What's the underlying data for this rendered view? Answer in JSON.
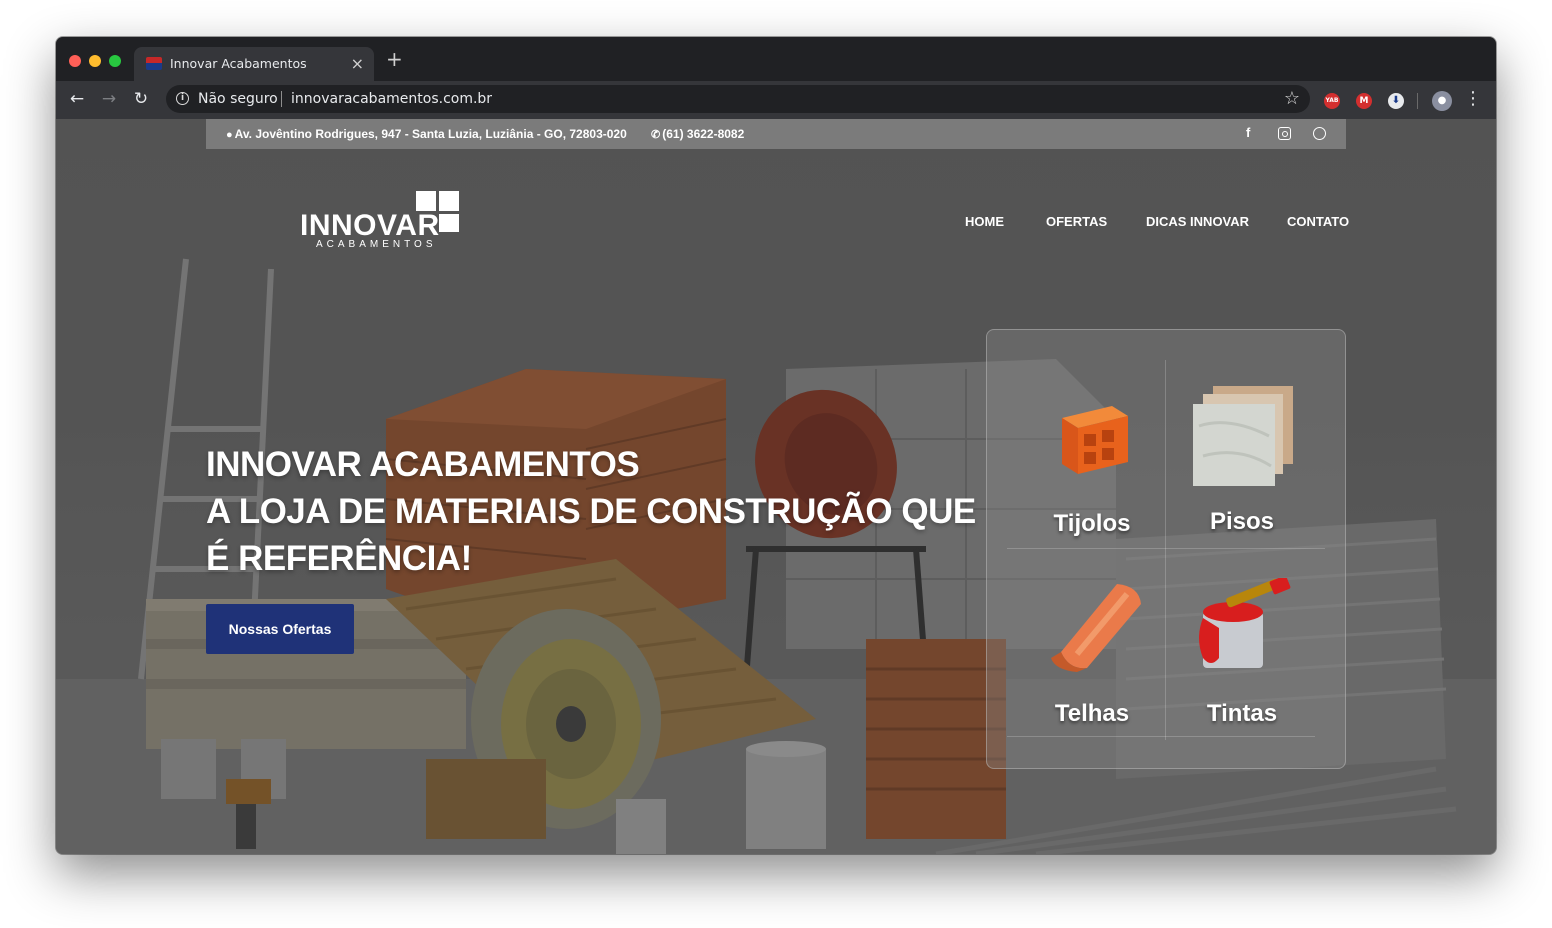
{
  "browser": {
    "tab_title": "Innovar Acabamentos",
    "tab_close": "×",
    "new_tab": "+",
    "security_label": "Não seguro",
    "url": "innovaracabamentos.com.br",
    "extensions": [
      "YAB",
      "M",
      "⬇"
    ]
  },
  "topbar": {
    "address": "Av. Jovêntino Rodrigues, 947 - Santa Luzia, Luziânia - GO, 72803-020",
    "phone": "(61) 3622-8082",
    "social": [
      "facebook-icon",
      "instagram-icon",
      "whatsapp-icon"
    ]
  },
  "logo": {
    "word": "INNOVAR",
    "sub": "ACABAMENTOS"
  },
  "menu": {
    "home": "HOME",
    "ofertas": "OFERTAS",
    "dicas": "DICAS INNOVAR",
    "contato": "CONTATO"
  },
  "hero": {
    "line1": "INNOVAR ACABAMENTOS",
    "line2": "A LOJA DE MATERIAIS DE CONSTRUÇÃO QUE",
    "line3": "É REFERÊNCIA!",
    "button": "Nossas Ofertas"
  },
  "categories": [
    {
      "label": "Tijolos"
    },
    {
      "label": "Pisos"
    },
    {
      "label": "Telhas"
    },
    {
      "label": "Tintas"
    }
  ],
  "colors": {
    "button_bg": "#1f3278",
    "topbar_bg": "#7b7b7b",
    "brick_orange": "#e8621c",
    "paint_red": "#d81e1e"
  }
}
